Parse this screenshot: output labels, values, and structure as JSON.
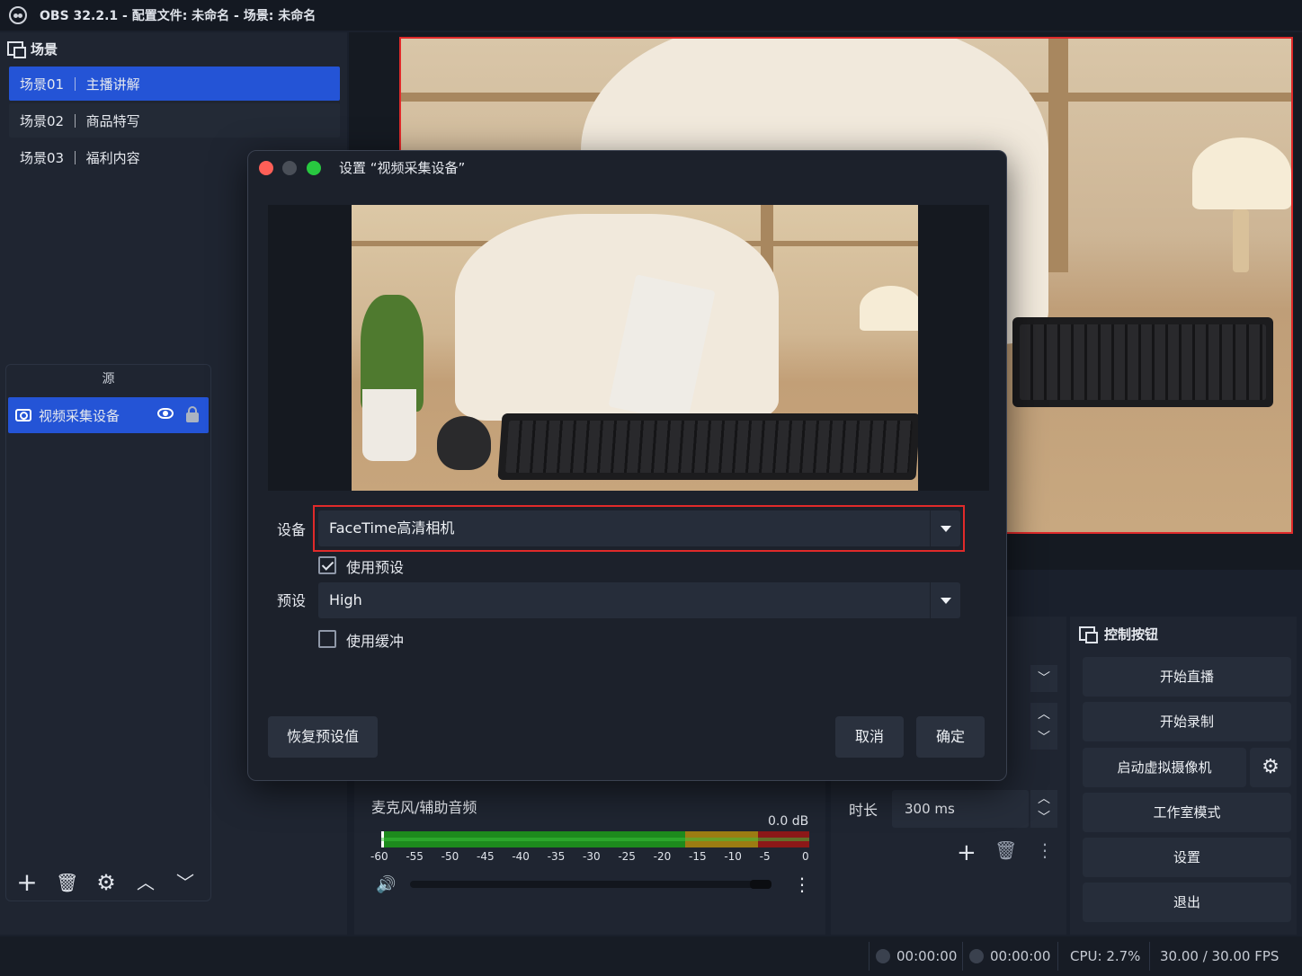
{
  "window": {
    "title": "OBS 32.2.1 - 配置文件: 未命名 - 场景: 未命名"
  },
  "scenes": {
    "header": "场景",
    "items": [
      {
        "label": "场景01 ｜ 主播讲解",
        "active": true
      },
      {
        "label": "场景02 ｜ 商品特写",
        "active": false
      },
      {
        "label": "场景03 ｜ 福利内容",
        "active": false
      }
    ]
  },
  "sources": {
    "header": "源",
    "items": [
      {
        "label": "视频采集设备",
        "icon": "camera-icon"
      }
    ],
    "toolbar": {
      "add": "+",
      "remove": "🗑",
      "settings": "⚙",
      "up": "︿",
      "down": "﹀"
    }
  },
  "mixer": {
    "label": "麦克风/辅助音频",
    "db": "0.0 dB",
    "ticks": [
      "-60",
      "-55",
      "-50",
      "-45",
      "-40",
      "-35",
      "-30",
      "-25",
      "-20",
      "-15",
      "-10",
      "-5",
      "0"
    ],
    "menu": "⋮",
    "volume_icon": "🔊"
  },
  "transitions": {
    "duration_label": "时长",
    "duration_value": "300 ms",
    "add": "+",
    "remove": "🗑",
    "menu": "⋮",
    "chevron_down": "﹀",
    "chevron_up": "︿"
  },
  "controls": {
    "header": "控制按钮",
    "buttons": [
      "开始直播",
      "开始录制",
      "启动虚拟摄像机",
      "工作室模式",
      "设置",
      "退出"
    ],
    "gear": "⚙"
  },
  "status": {
    "stream_time": "00:00:00",
    "record_time": "00:00:00",
    "cpu": "CPU: 2.7%",
    "fps": "30.00 / 30.00 FPS"
  },
  "dialog": {
    "title": "设置 “视频采集设备”",
    "device_label": "设备",
    "device_value": "FaceTime高清相机",
    "use_preset_label": "使用预设",
    "use_preset_checked": true,
    "preset_label": "预设",
    "preset_value": "High",
    "use_buffer_label": "使用缓冲",
    "use_buffer_checked": false,
    "restore_button": "恢复预设值",
    "cancel_button": "取消",
    "ok_button": "确定"
  },
  "colors": {
    "accent": "#2454d6",
    "highlight": "#e02a2a",
    "background": "#1a202c",
    "traffic_red": "#ff5f57",
    "traffic_gray": "#4a4f58",
    "traffic_green": "#28c840"
  }
}
